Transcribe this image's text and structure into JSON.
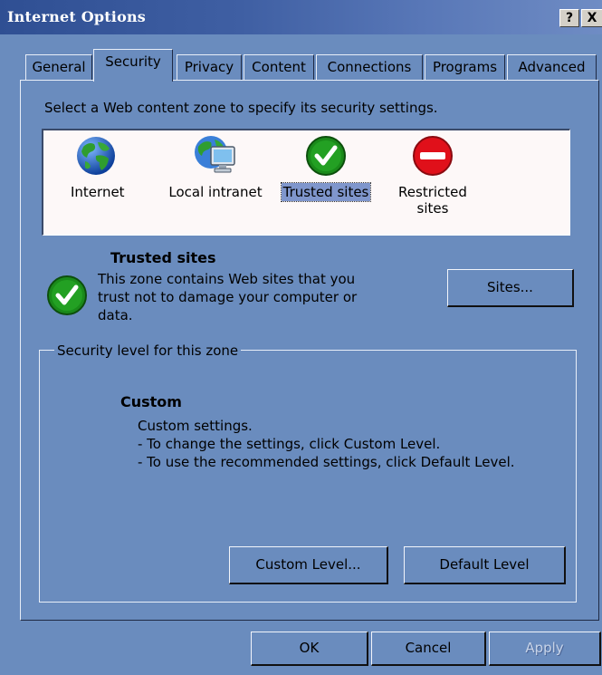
{
  "window": {
    "title": "Internet Options",
    "help_label": "?",
    "close_label": "X"
  },
  "tabs": [
    {
      "label": "General",
      "active": false
    },
    {
      "label": "Security",
      "active": true
    },
    {
      "label": "Privacy",
      "active": false
    },
    {
      "label": "Content",
      "active": false
    },
    {
      "label": "Connections",
      "active": false
    },
    {
      "label": "Programs",
      "active": false
    },
    {
      "label": "Advanced",
      "active": false
    }
  ],
  "security": {
    "zone_prompt": "Select a Web content zone to specify its security settings.",
    "zones": [
      {
        "label": "Internet",
        "icon": "globe-icon",
        "selected": false
      },
      {
        "label": "Local intranet",
        "icon": "intranet-monitor-icon",
        "selected": false
      },
      {
        "label": "Trusted sites",
        "icon": "checkmark-icon",
        "selected": true
      },
      {
        "label": "Restricted\nsites",
        "icon": "no-entry-icon",
        "selected": false
      }
    ],
    "selected_zone": {
      "title": "Trusted sites",
      "description": "This zone contains Web sites that you trust not to damage your computer or data.",
      "icon": "checkmark-icon"
    },
    "sites_button": "Sites...",
    "level_group_label": "Security level for this zone",
    "level": {
      "title": "Custom",
      "lines": [
        "Custom settings.",
        "- To change the settings, click Custom Level.",
        "- To use the recommended settings, click Default Level."
      ]
    },
    "custom_level_button": "Custom Level...",
    "default_level_button": "Default Level"
  },
  "footer": {
    "ok": "OK",
    "cancel": "Cancel",
    "apply": "Apply"
  },
  "colors": {
    "dialog_bg": "#6a8cbe",
    "title_bar": "#2f4f93",
    "zone_list_bg": "#fdf8f8",
    "selection": "#7f96cc"
  }
}
